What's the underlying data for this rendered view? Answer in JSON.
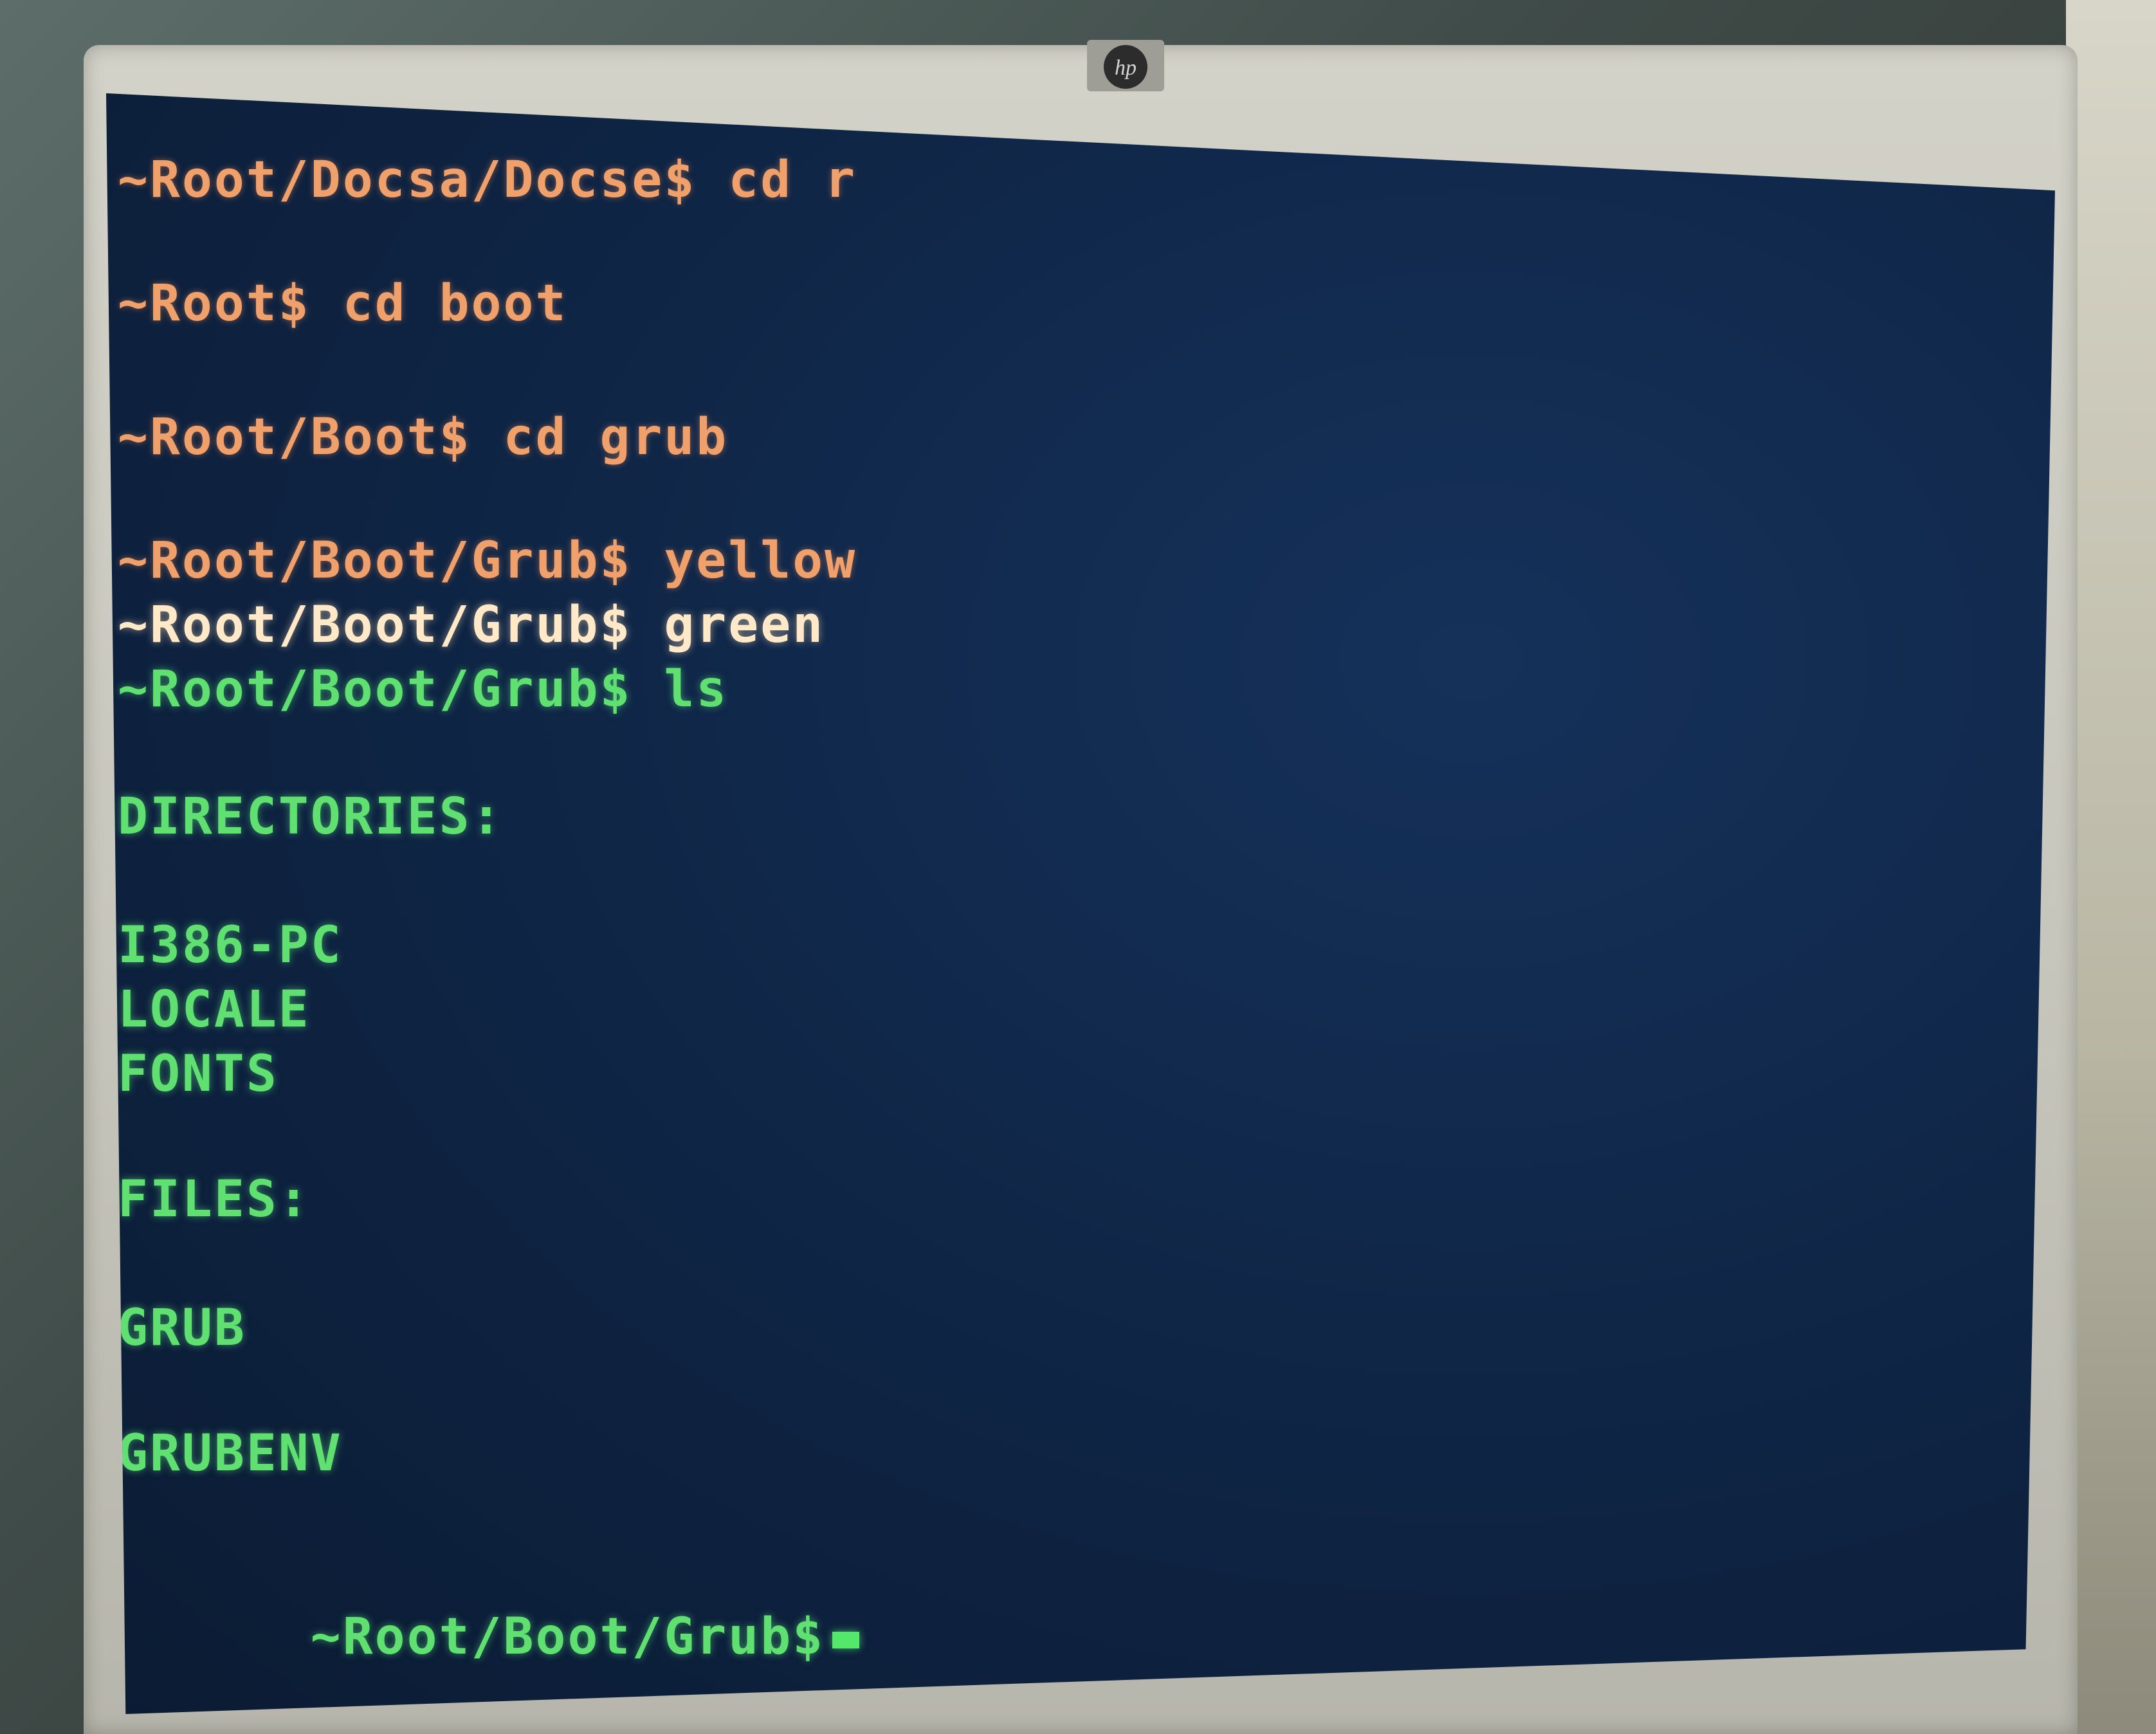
{
  "monitor": {
    "brand_logo": "hp"
  },
  "terminal": {
    "lines": [
      "~Root/Docsa/Docse$ cd r",
      "~Root$ cd boot",
      "~Root/Boot$ cd grub",
      "~Root/Boot/Grub$ yellow",
      "~Root/Boot/Grub$ green",
      "~Root/Boot/Grub$ ls",
      "DIRECTORIES:",
      "I386-PC",
      "LOCALE",
      "FONTS",
      "FILES:",
      "GRUB",
      "GRUBENV",
      "~Root/Boot/Grub$"
    ]
  },
  "colors": {
    "prompt_orange": "#f0a06a",
    "prompt_white": "#ffe9c8",
    "text_green": "#5fe070",
    "screen_bg": "#0f2647"
  }
}
